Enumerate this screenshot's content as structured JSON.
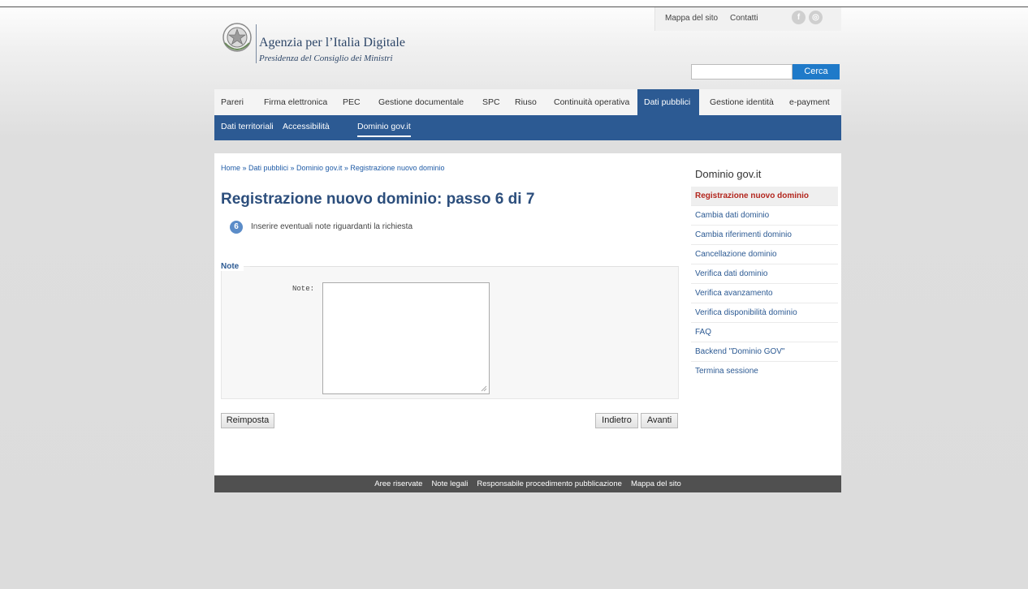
{
  "utility": {
    "mappa": "Mappa del sito",
    "contatti": "Contatti",
    "facebook_icon": "f",
    "rss_icon": "◎"
  },
  "logo": {
    "title": "Agenzia per l’Italia Digitale",
    "subtitle": "Presidenza del Consiglio dei Ministri"
  },
  "search": {
    "value": "",
    "button_label": "Cerca"
  },
  "main_nav": [
    {
      "label": "Pareri"
    },
    {
      "label": "Firma elettronica"
    },
    {
      "label": "PEC"
    },
    {
      "label": "Gestione documentale"
    },
    {
      "label": "SPC"
    },
    {
      "label": "Riuso"
    },
    {
      "label": "Continuità operativa"
    },
    {
      "label": "Dati pubblici",
      "active": true
    },
    {
      "label": "Gestione identità"
    },
    {
      "label": "e-payment"
    }
  ],
  "sub_nav": [
    {
      "label": "Dati territoriali"
    },
    {
      "label": "Accessibilità"
    },
    {
      "label": "Dominio gov.it",
      "active": true
    }
  ],
  "breadcrumb": "Home » Dati pubblici » Dominio gov.it » Registrazione nuovo dominio",
  "page_title": "Registrazione nuovo dominio: passo 6 di 7",
  "step": {
    "number": "6",
    "text": "Inserire eventuali note riguardanti la richiesta"
  },
  "form": {
    "legend": "Note",
    "note_label": "Note:",
    "note_value": ""
  },
  "buttons": {
    "reimposta": "Reimposta",
    "indietro": "Indietro",
    "avanti": "Avanti"
  },
  "side_menu": {
    "title": "Dominio gov.it",
    "items": [
      {
        "label": "Registrazione nuovo dominio",
        "active": true
      },
      {
        "label": "Cambia dati dominio"
      },
      {
        "label": "Cambia riferimenti dominio"
      },
      {
        "label": "Cancellazione dominio"
      },
      {
        "label": "Verifica dati dominio"
      },
      {
        "label": "Verifica avanzamento"
      },
      {
        "label": "Verifica disponibilità dominio"
      },
      {
        "label": "FAQ"
      },
      {
        "label": "Backend \"Dominio GOV\""
      },
      {
        "label": "Termina sessione"
      }
    ]
  },
  "footer": [
    {
      "label": "Aree riservate"
    },
    {
      "label": "Note legali"
    },
    {
      "label": "Responsabile procedimento pubblicazione"
    },
    {
      "label": "Mappa del sito"
    }
  ],
  "colors": {
    "brand_blue": "#2c5a93",
    "title_blue": "#2c4e7c",
    "active_red": "#b3261e",
    "search_button": "#1f7ac9"
  }
}
